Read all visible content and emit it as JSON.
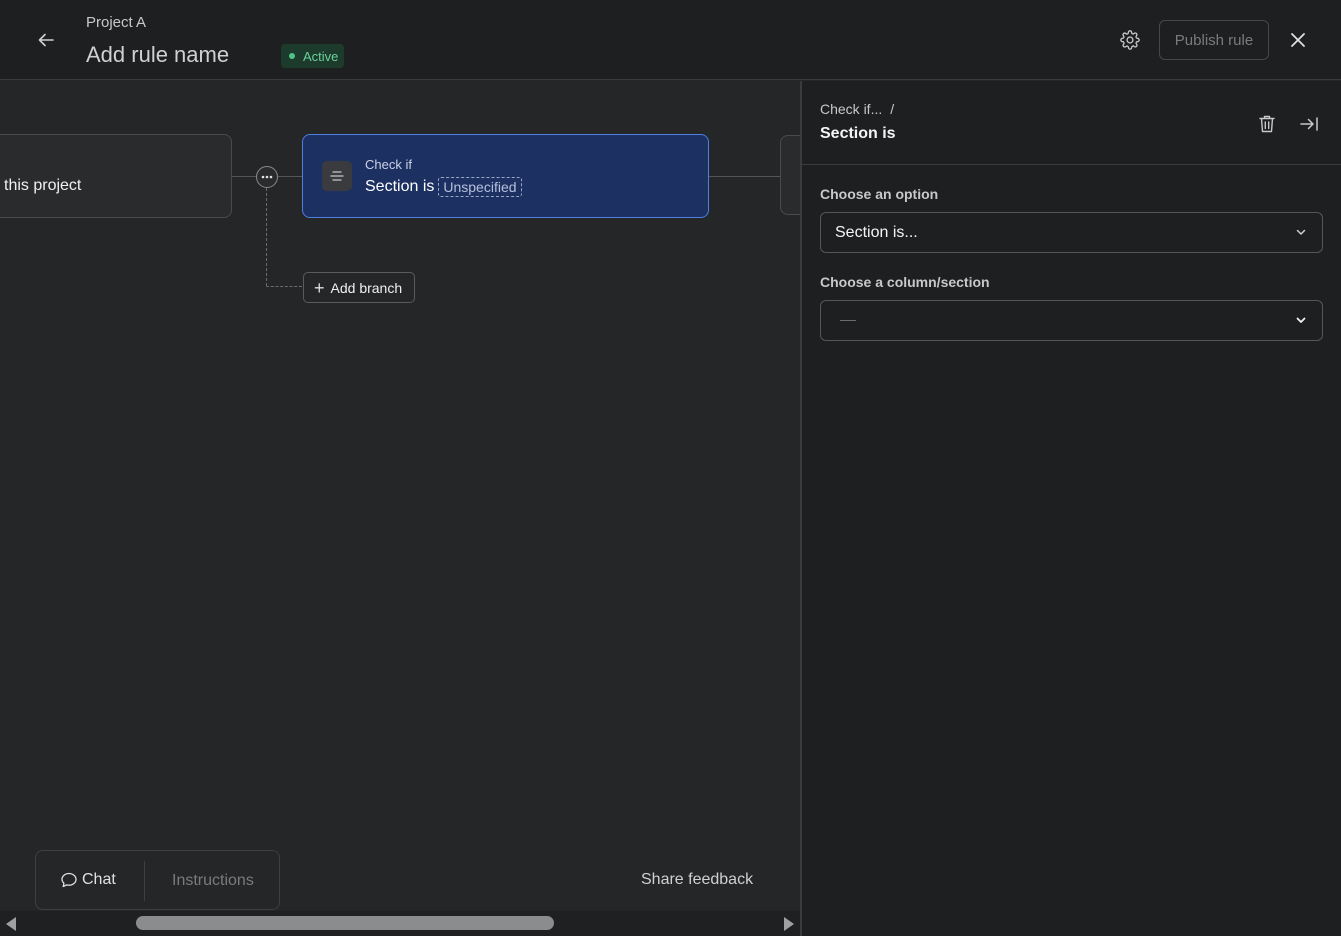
{
  "header": {
    "project_name": "Project A",
    "rule_name": "Add rule name",
    "status": "Active",
    "publish_label": "Publish rule"
  },
  "canvas": {
    "trigger_label": "this project",
    "check_title": "Check if",
    "check_condition": "Section is",
    "check_value": "Unspecified",
    "add_branch_label": "Add branch"
  },
  "bottom": {
    "chat_label": "Chat",
    "instructions_label": "Instructions",
    "share_feedback_label": "Share feedback"
  },
  "panel": {
    "breadcrumb": "Check if...",
    "breadcrumb_sep": "/",
    "title": "Section is",
    "option_label": "Choose an option",
    "option_value": "Section is...",
    "column_label": "Choose a column/section"
  },
  "colors": {
    "accent_blue": "#4f7ee0",
    "active_green": "#4fc486"
  }
}
